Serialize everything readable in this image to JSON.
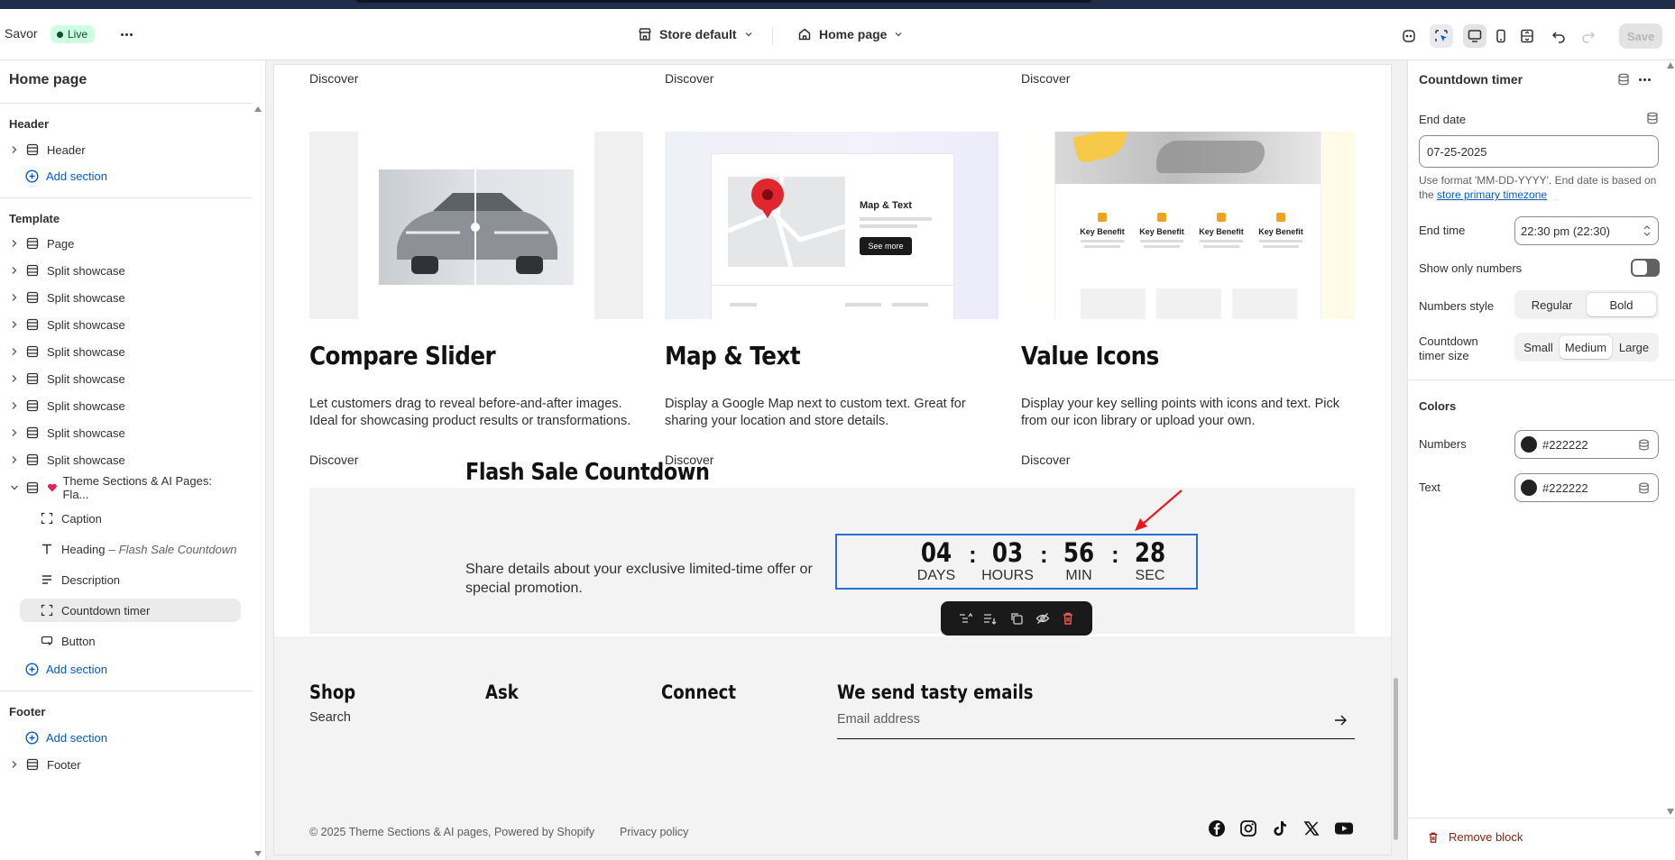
{
  "topbar": {
    "store_name": "Savor",
    "status": "Live",
    "theme_select": "Store default",
    "page_select": "Home page",
    "save_label": "Save"
  },
  "left": {
    "title": "Home page",
    "header_group": "Header",
    "header_item": "Header",
    "add_section": "Add section",
    "template_group": "Template",
    "template_items": [
      "Page",
      "Split showcase",
      "Split showcase",
      "Split showcase",
      "Split showcase",
      "Split showcase",
      "Split showcase",
      "Split showcase",
      "Split showcase"
    ],
    "expanded_section": "Theme Sections & AI Pages: Fla...",
    "blocks": {
      "caption": "Caption",
      "heading": "Heading",
      "heading_sub": "Flash Sale Countdown",
      "description": "Description",
      "countdown": "Countdown timer",
      "button": "Button"
    },
    "footer_group": "Footer",
    "footer_item": "Footer"
  },
  "canvas": {
    "discover": "Discover",
    "cards": [
      {
        "title": "Compare Slider",
        "desc": "Let customers drag to reveal before-and-after images. Ideal for showcasing product results or transformations."
      },
      {
        "title": "Map & Text",
        "desc": "Display a Google Map next to custom text. Great for sharing your location and store details."
      },
      {
        "title": "Value Icons",
        "desc": "Display your key selling points with icons and text. Pick from our icon library or upload your own."
      }
    ],
    "map_card_heading": "Map & Text",
    "map_card_button": "See more",
    "key_benefit": "Key Benefit",
    "flash": {
      "title": "Flash Sale Countdown",
      "desc": "Share details about your exclusive limited-time offer or special promotion.",
      "units": [
        {
          "value": "04",
          "label": "DAYS"
        },
        {
          "value": "03",
          "label": "HOURS"
        },
        {
          "value": "56",
          "label": "MIN"
        },
        {
          "value": "28",
          "label": "SEC"
        }
      ],
      "separator": ":"
    },
    "footer": {
      "headings": [
        "Shop",
        "Ask",
        "Connect",
        "We send tasty emails"
      ],
      "shop_link": "Search",
      "email_placeholder": "Email address",
      "copyright": "© 2025 Theme Sections & AI pages, Powered by Shopify",
      "privacy": "Privacy policy"
    }
  },
  "right": {
    "title": "Countdown timer",
    "end_date_label": "End date",
    "end_date_value": "07-25-2025",
    "help_text": "Use format 'MM-DD-YYYY'. End date is based on the",
    "help_link": "store primary timezone",
    "end_time_label": "End time",
    "end_time_value": "22:30 pm (22:30)",
    "show_only_numbers_label": "Show only numbers",
    "show_only_numbers": false,
    "numbers_style_label": "Numbers style",
    "numbers_style_options": [
      "Regular",
      "Bold"
    ],
    "numbers_style_selected": "Bold",
    "size_label": "Countdown timer size",
    "size_options": [
      "Small",
      "Medium",
      "Large"
    ],
    "size_selected": "Medium",
    "colors_heading": "Colors",
    "numbers_color_label": "Numbers",
    "numbers_color": "#222222",
    "text_color_label": "Text",
    "text_color": "#222222",
    "remove_label": "Remove block"
  },
  "colors": {
    "accent": "#005bd3",
    "selection_outline": "#2c6ecb",
    "live_badge": "#cdfee1",
    "danger": "#8e1f0b"
  }
}
